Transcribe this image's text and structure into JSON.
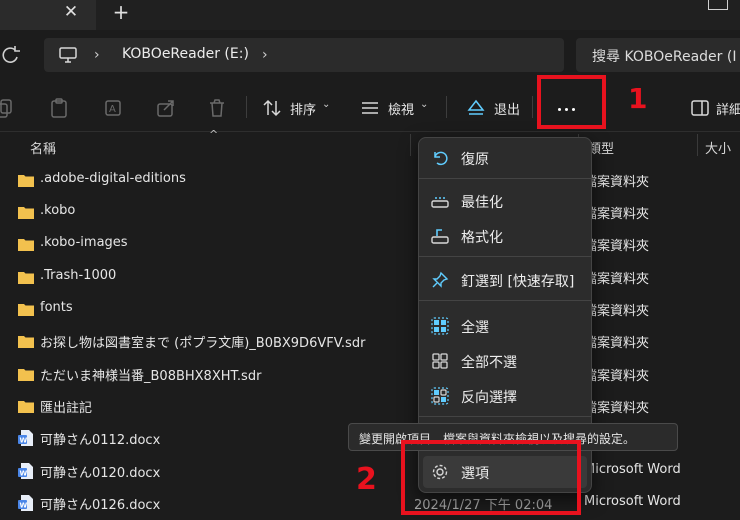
{
  "tabbar": {
    "close_glyph": "✕",
    "new_tab_glyph": "+"
  },
  "address": {
    "path_segment": "KOBOeReader (E:)",
    "search_placeholder": "搜尋 KOBOeReader (I"
  },
  "toolbar": {
    "sort_label": "排序",
    "view_label": "檢視",
    "eject_label": "退出",
    "details_label": "詳細"
  },
  "columns": {
    "name": "名稱",
    "type": "類型",
    "size": "大小"
  },
  "files": [
    {
      "name": ".adobe-digital-editions",
      "kind": "folder",
      "type": "檔案資料夾"
    },
    {
      "name": ".kobo",
      "kind": "folder",
      "type": "檔案資料夾"
    },
    {
      "name": ".kobo-images",
      "kind": "folder",
      "type": "檔案資料夾"
    },
    {
      "name": ".Trash-1000",
      "kind": "folder",
      "type": "檔案資料夾"
    },
    {
      "name": "fonts",
      "kind": "folder",
      "type": "檔案資料夾"
    },
    {
      "name": "お探し物は図書室まで (ポプラ文庫)_B0BX9D6VFV.sdr",
      "kind": "folder",
      "type": "檔案資料夾"
    },
    {
      "name": "ただいま神様当番_B08BHX8XHT.sdr",
      "kind": "folder",
      "type": "檔案資料夾"
    },
    {
      "name": "匯出註記",
      "kind": "folder",
      "type": "檔案資料夾"
    },
    {
      "name": "可静さん0112.docx",
      "kind": "word",
      "type": ""
    },
    {
      "name": "可静さん0120.docx",
      "kind": "word",
      "type": "Microsoft Word"
    },
    {
      "name": "可静さん0126.docx",
      "kind": "word",
      "type": "Microsoft Word",
      "date": "2024/1/27 下午 02:04"
    }
  ],
  "menu": {
    "items": [
      {
        "label": "復原",
        "icon": "undo-icon"
      },
      {
        "label": "最佳化",
        "icon": "optimize-drive-icon"
      },
      {
        "label": "格式化",
        "icon": "format-drive-icon"
      },
      {
        "label": "釘選到 [快速存取]",
        "icon": "pin-icon"
      },
      {
        "label": "全選",
        "icon": "select-all-icon"
      },
      {
        "label": "全部不選",
        "icon": "select-none-icon"
      },
      {
        "label": "反向選擇",
        "icon": "invert-selection-icon"
      },
      {
        "label": "選項",
        "icon": "gear-icon"
      }
    ]
  },
  "tooltip": "變更開啟項目、檔案與資料夾檢視以及搜尋的設定。",
  "annotations": {
    "step1": "1",
    "step2": "2",
    "color": "#e8121e"
  },
  "colors": {
    "folder": "#f2c14e",
    "word": "#4a86e8",
    "accent": "#60cdff"
  }
}
